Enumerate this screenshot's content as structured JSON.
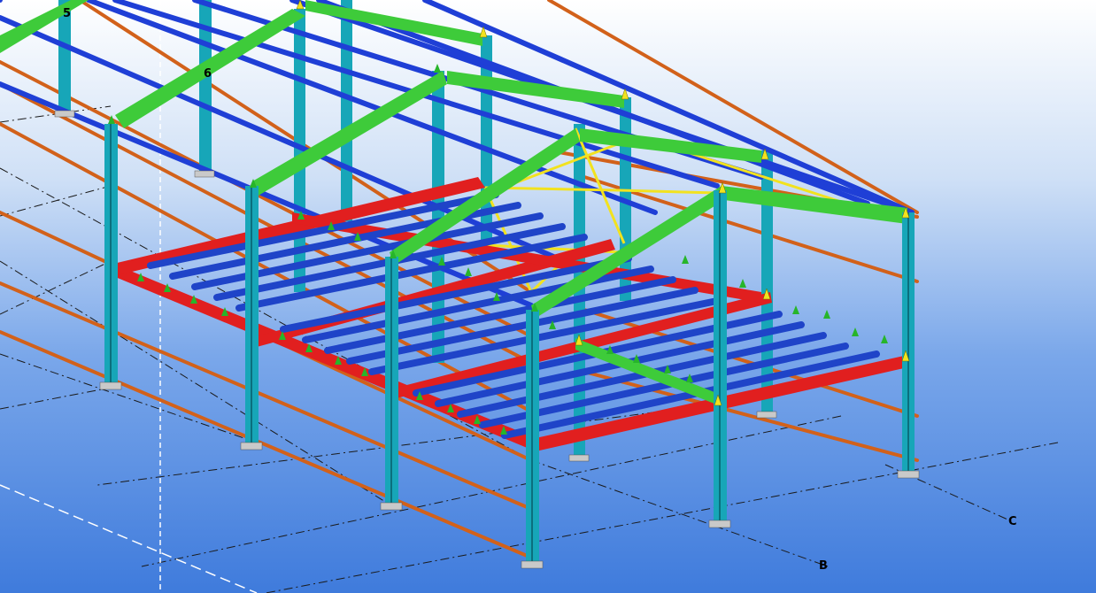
{
  "viewport": {
    "background_top": "#ffffff",
    "background_bottom": "#3f7bdc"
  },
  "grid_labels": {
    "label_5": "5",
    "label_6": "6",
    "label_b": "B",
    "label_c": "C"
  },
  "colors": {
    "column": "#17a6b8",
    "column_dark": "#0b6f7d",
    "rafter": "#3ecb3a",
    "purlin_blue": "#1f3fd6",
    "girt_orange": "#d2611a",
    "floor_beam_red": "#e11f1f",
    "joist_blue": "#1f44c8",
    "bracing_yellow": "#f2e21f",
    "grid_line": "#1a1a1a",
    "base_plate": "#c9c9c9"
  },
  "icons": {
    "connection_marker": "connection-arrow-icon"
  }
}
